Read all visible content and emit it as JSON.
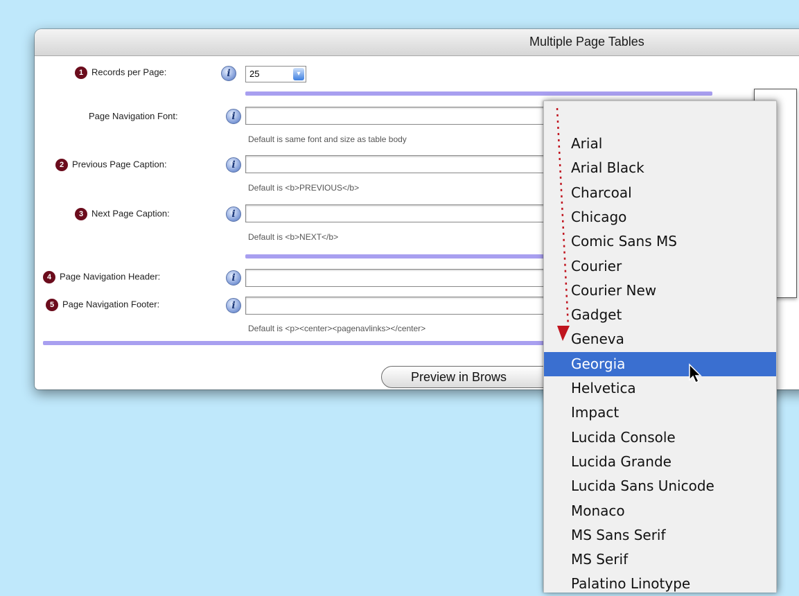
{
  "window": {
    "title": "Multiple Page Tables"
  },
  "rows": {
    "records": {
      "badge": "1",
      "label": "Records per Page:",
      "value": "25"
    },
    "nav_font": {
      "label": "Page Navigation Font:",
      "hint": "Default is same font and size as table body"
    },
    "prev": {
      "badge": "2",
      "label": "Previous Page Caption:",
      "hint": "Default is <b>PREVIOUS</b>"
    },
    "next": {
      "badge": "3",
      "label": "Next Page Caption:",
      "hint": "Default is <b>NEXT</b>"
    },
    "header": {
      "badge": "4",
      "label": "Page Navigation Header:"
    },
    "footer": {
      "badge": "5",
      "label": "Page Navigation Footer:",
      "hint": "Default is <p><center><pagenavlinks></center>"
    }
  },
  "buttons": {
    "preview": "Preview in Brows"
  },
  "info_icon": "i",
  "font_menu": {
    "selected": "Georgia",
    "items": [
      "Arial",
      "Arial Black",
      "Charcoal",
      "Chicago",
      "Comic Sans MS",
      "Courier",
      "Courier New",
      "Gadget",
      "Geneva",
      "Georgia",
      "Helvetica",
      "Impact",
      "Lucida Console",
      "Lucida Grande",
      "Lucida Sans Unicode",
      "Monaco",
      "MS Sans Serif",
      "MS Serif",
      "Palatino Linotype"
    ]
  },
  "colors": {
    "background": "#bfe8fb",
    "badge": "#6b0c1c",
    "separator": "#a89ff0",
    "selection": "#3a6fd0",
    "arrow": "#c0141e"
  }
}
